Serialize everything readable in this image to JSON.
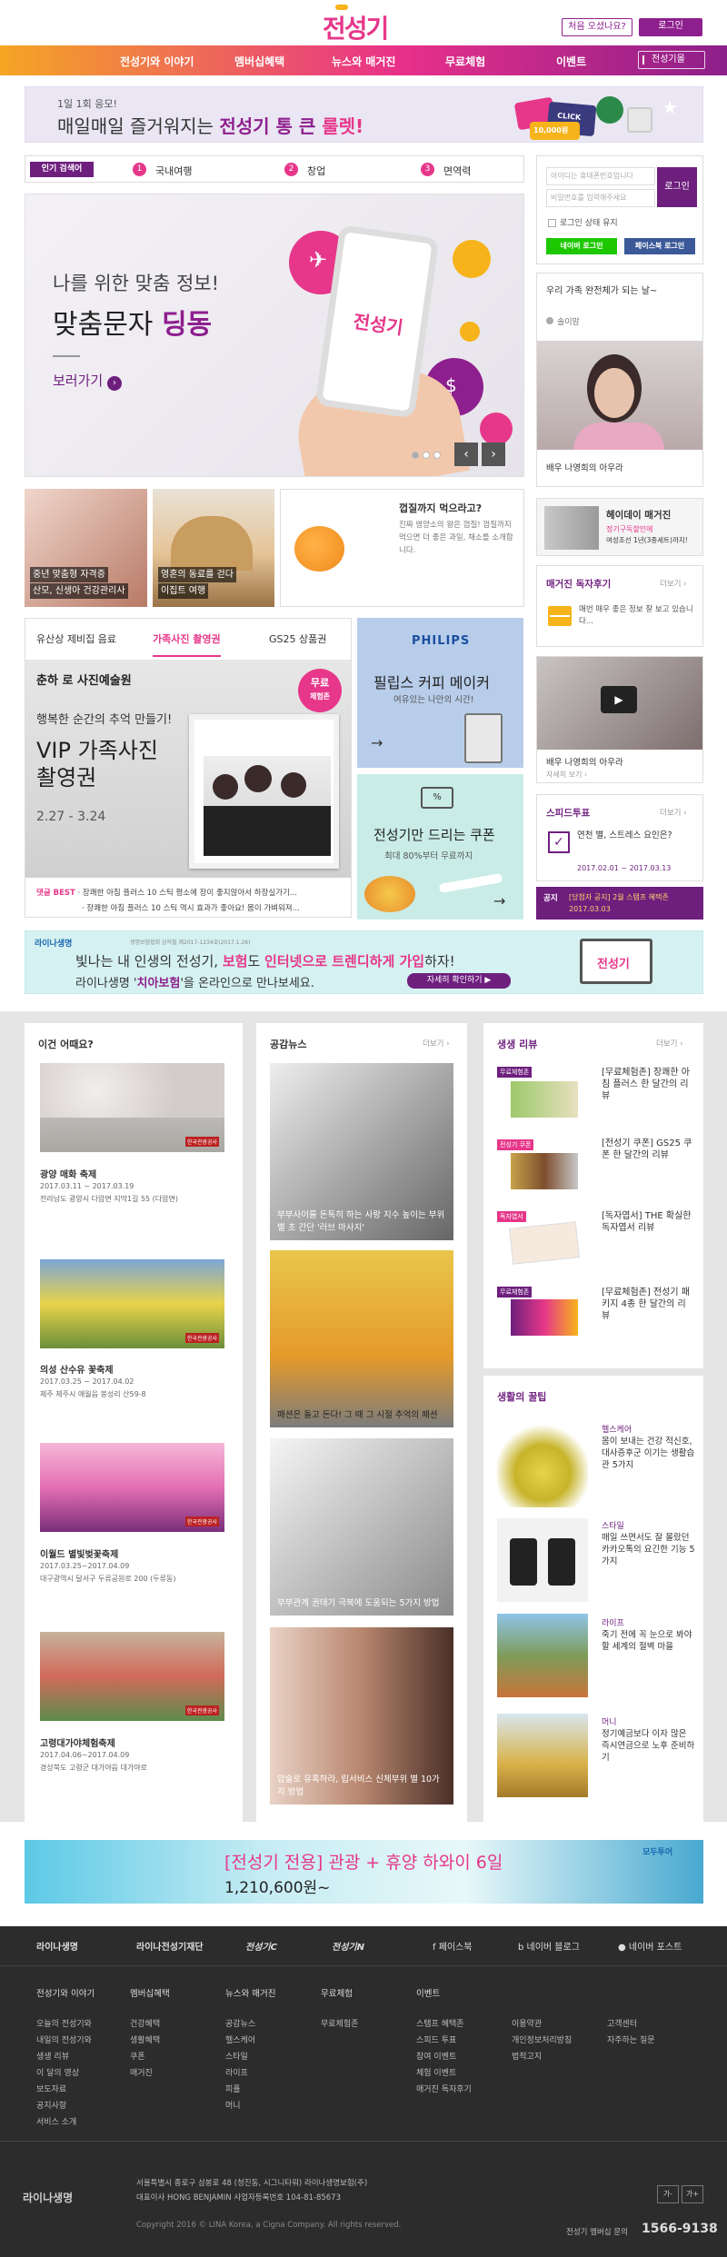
{
  "header": {
    "logo": "전성기",
    "first_visit_label": "처음 오셨나요?",
    "login_label": "로그인"
  },
  "gnb": {
    "items": [
      "전성기와 이야기",
      "멤버십혜택",
      "뉴스와 매거진",
      "무료체험",
      "이벤트"
    ],
    "search_label": "전성기몰"
  },
  "promo": {
    "small": "1일 1회 응모!",
    "big_prefix": "매일매일 즐거워지는 ",
    "big_brand": "전성기 통 큰 ",
    "big_em": "룰렛!",
    "card_click": "CLICK",
    "card_amount": "10,000원"
  },
  "keywords": {
    "badge": "인기 검색어",
    "items": [
      {
        "rank": "1",
        "text": "국내여행"
      },
      {
        "rank": "2",
        "text": "창업"
      },
      {
        "rank": "3",
        "text": "면역력"
      }
    ]
  },
  "login": {
    "id_placeholder": "아이디는 휴대폰번호입니다",
    "pw_placeholder": "비밀번호를 입력해주세요",
    "button": "로그인",
    "keep": "로그인 상태 유지",
    "naver": "네이버 로그인",
    "facebook": "페이스북 로그인"
  },
  "hero": {
    "line1": "나를 위한 맞춤 정보!",
    "line2_prefix": "맞춤문자 ",
    "line2_em": "딩동",
    "cta": "보러가기",
    "phone_logo": "전성기",
    "prev": "‹",
    "next": "›"
  },
  "right_col": {
    "question": "우리 가족 완전체가 되는 날~",
    "user": "솔이맘",
    "actor_caption": "배우 나영희의 아우라",
    "magazine_title": "헤이데이 매거진",
    "magazine_desc1": "정기구독할인에",
    "magazine_desc2": "여성조선 1년(3종세트)까지!",
    "reader_title": "매거진 독자후기",
    "reader_more": "더보기 ›",
    "reader_text": "매번 매우 좋은 정보 잘 보고 있습니다...",
    "video_caption": "배우 나영희의 아우라",
    "video_more": "자세히 보기 ›",
    "poll_title": "스피드투표",
    "poll_more": "더보기 ›",
    "poll_q": "연천 별, 스트레스 요인은?",
    "poll_date": "2017.02.01 ~ 2017.03.13",
    "notice_badge": "공지",
    "notice_text": "[당첨자 공지] 2월 스탬프 혜택존",
    "notice_date": "2017.03.03"
  },
  "photo_row": [
    {
      "caption1": "중년 맞춤형 자격증",
      "caption2": "산모, 신생아 건강관리사"
    },
    {
      "caption1": "영혼의 동료를 걷다",
      "caption2": "이집트 여행"
    }
  ],
  "tangerine": {
    "title": "껍질까지 먹으라고?",
    "desc": "진짜 영양소의 왕은 껍질! 껍질까지 먹으면 더 좋은 과일, 채소를 소개합니다."
  },
  "gift": {
    "tabs": [
      "유산상 제비집 음료",
      "가족사진 촬영권",
      "GS25 상품권"
    ],
    "studio": "춘하 로 사진예술원",
    "line1": "행복한 순간의 추억 만들기!",
    "title1": "VIP 가족사진",
    "title2": "촬영권",
    "period": "2.27 - 3.24",
    "badge1": "무료",
    "badge2": "체험존",
    "best_label": "댓글 BEST",
    "best1": "장쾌한 아침 플러스 10 스틱  평소에 장이 좋지않아서 하장실가기...",
    "best2": "장쾌한 아침 플러스 10 스틱  역시 효과가 좋아요! 몸이 가벼워져..."
  },
  "philips": {
    "brand": "PHILIPS",
    "title": "필립스 커피 메이커",
    "sub": "여유있는 나만의 시간!",
    "arrow": "→"
  },
  "coupon": {
    "title": "전성기만 드리는 쿠폰",
    "sub": "최대 80%부터 무료까지",
    "arrow": "→"
  },
  "lina_banner": {
    "brand": "라이나생명",
    "cert": "생명보험협회 심의필 제2017-1234호(2017.1.26)",
    "line1_a": "빛나는 내 인생의 전성기, ",
    "line1_b": "보험",
    "line1_c": "도 ",
    "line1_d": "인터넷으로 트렌디하게 가입",
    "line1_e": "하자!",
    "line2_a": "라이나생명 '",
    "line2_b": "치아보험",
    "line2_c": "'을 온라인으로 만나보세요.",
    "cta": "자세히 확인하기 ▶"
  },
  "festivals": {
    "title": "이건 어때요?",
    "items": [
      {
        "name": "광양 매화 축제",
        "date": "2017.03.11 ~ 2017.03.19",
        "place": "전라남도 광양시 다압면 지막1길 55 (다압면)"
      },
      {
        "name": "의성 산수유 꽃축제",
        "date": "2017.03.25 ~ 2017.04.02",
        "place": "제주 제주시 애월읍 봉성리 산59-8"
      },
      {
        "name": "이월드 별빛벚꽃축제",
        "date": "2017.03.25~2017.04.09",
        "place": "대구광역시 달서구 두류공원로 200 (두류동)"
      },
      {
        "name": "고령대가야체험축제",
        "date": "2017.04.06~2017.04.09",
        "place": "경상북도 고령군 대가야읍 대가야로"
      }
    ],
    "tag": "한국관광공사"
  },
  "news": {
    "title": "공감뉴스",
    "more": "더보기 ›",
    "items": [
      "부부사이를 돈독히 하는 사랑 지수 높이는 부위별 초 간단 '러브 마사지'",
      "패션은 돌고 돈다! 그 때 그 시절 추억의 패션",
      "부부관계 권태기 극복에 도움되는 5가지 방법",
      "압술로 유혹하라, 립서비스 신체부위 별 10가지 방법"
    ]
  },
  "reviews": {
    "title": "생생 리뷰",
    "more": "더보기 ›",
    "items": [
      {
        "badge": "무료체험존",
        "title": "[무료체험존] 장쾌한 아침 플러스 한 달간의 리뷰"
      },
      {
        "badge": "전성기 쿠폰",
        "title": "[전성기 쿠폰] GS25 쿠폰 한 달간의 리뷰"
      },
      {
        "badge": "독자엽서",
        "title": "[독자엽서] THE 확실한 독자엽서 리뷰"
      },
      {
        "badge": "무료체험존",
        "title": "[무료체험존] 전성기 패키지 4종 한 달간의 리뷰"
      }
    ]
  },
  "tips": {
    "title": "생활의 꿀팁",
    "items": [
      {
        "category": "헬스케어",
        "title": "몸이 보내는 건강 적신호, 대사증후군 이기는 생활습관 5가지"
      },
      {
        "category": "스타일",
        "title": "매일 쓰면서도 잘 몰랐던 카카오톡의 요긴한 기능 5가지"
      },
      {
        "category": "라이프",
        "title": "죽기 전에 꼭 눈으로 봐야 할 세계의 절벽 마을"
      },
      {
        "category": "머니",
        "title": "정기예금보다 이자 많은 즉시연금으로 노후 준비하기"
      }
    ]
  },
  "hawaii": {
    "title_a": "[전성기 전용] ",
    "title_b": "관광 + 휴양 하와이 6일",
    "price": "1,210,600원~",
    "brand": "모두투어"
  },
  "footer": {
    "brands": [
      "라이나생명",
      "라이나전성기재단",
      "전성기C",
      "전성기N"
    ],
    "sns": [
      "페이스북",
      "네이버 블로그",
      "네이버 포스트"
    ],
    "columns": [
      {
        "head": "전성기와 이야기",
        "items": [
          "오늘의 전성기와",
          "내일의 전성기와",
          "생생 리뷰",
          "이 달의 영상",
          "보도자료",
          "공지사항",
          "서비스 소개"
        ]
      },
      {
        "head": "멤버십혜택",
        "items": [
          "건강혜택",
          "생활혜택",
          "쿠폰",
          "매거진"
        ]
      },
      {
        "head": "뉴스와 매거진",
        "items": [
          "공감뉴스",
          "헬스케어",
          "스타일",
          "라이프",
          "피플",
          "머니"
        ]
      },
      {
        "head": "무료체험",
        "items": [
          "무료체험존"
        ]
      },
      {
        "head": "이벤트",
        "items": [
          "스탬프 혜택존",
          "스피드 투표",
          "참여 이벤트",
          "체험 이벤트",
          "매거진 독자후기"
        ]
      },
      {
        "head": "",
        "items": [
          "이용약관",
          "개인정보처리방침",
          "법적고지"
        ]
      },
      {
        "head": "",
        "items": [
          "고객센터",
          "자주하는 질문"
        ]
      }
    ],
    "company": "라이나생명",
    "address": "서울특별시 종로구 삼봉로 48 (청진동, 시그니타워) 라이나생명보험(주)",
    "ceo": "대표이사 HONG BENJAMIN    사업자등록번호 104-81-85673",
    "copyright": "Copyright 2016 © LINA Korea, a Cigna Company. All rights reserved.",
    "font_minus": "가-",
    "font_plus": "가+",
    "cs_label": "전성기 멤버십 문의",
    "cs_phone": "1566-9138"
  }
}
